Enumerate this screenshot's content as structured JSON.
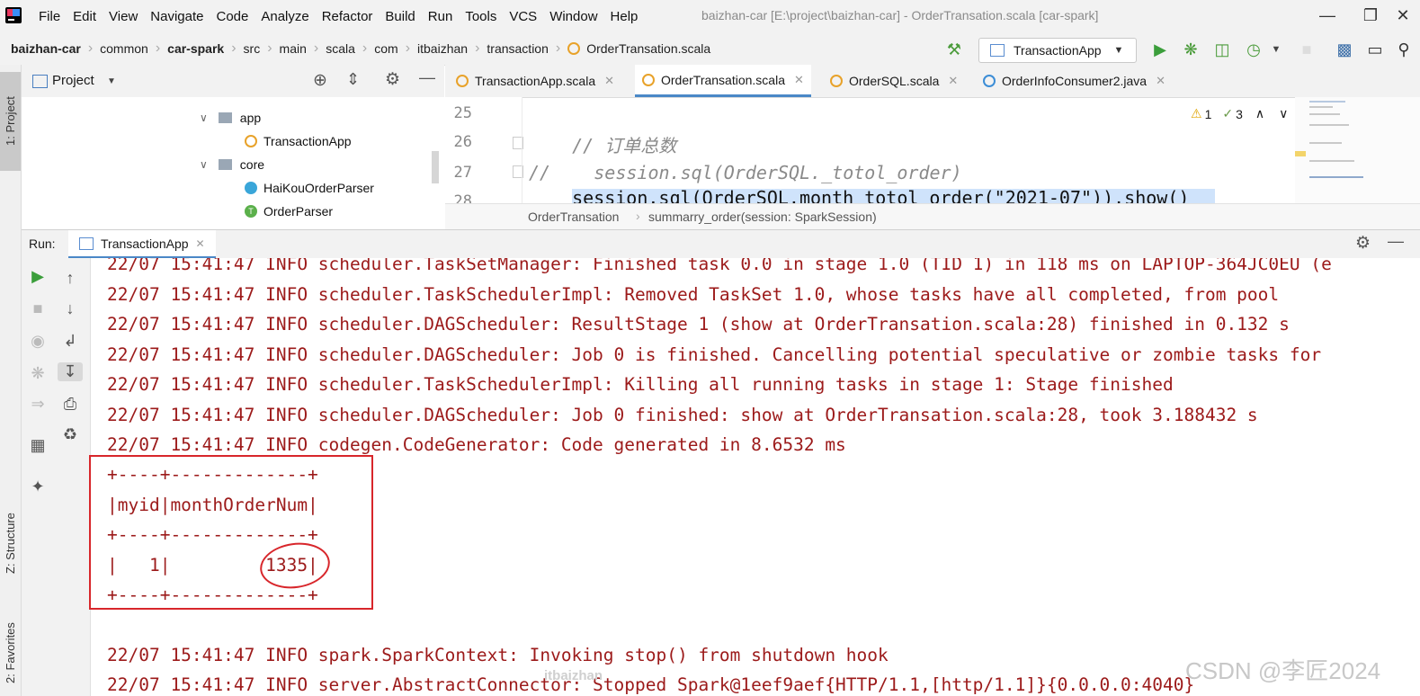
{
  "window": {
    "title": "baizhan-car [E:\\project\\baizhan-car] - OrderTransation.scala [car-spark]",
    "menu": [
      "File",
      "Edit",
      "View",
      "Navigate",
      "Code",
      "Analyze",
      "Refactor",
      "Build",
      "Run",
      "Tools",
      "VCS",
      "Window",
      "Help"
    ]
  },
  "nav": {
    "breadcrumbs": [
      "baizhan-car",
      "common",
      "car-spark",
      "src",
      "main",
      "scala",
      "com",
      "itbaizhan",
      "transaction",
      "OrderTransation.scala"
    ],
    "run_config": "TransactionApp"
  },
  "left_stripe": {
    "project_tab": "1: Project",
    "structure_tab": "Z: Structure",
    "favorites_tab": "2: Favorites"
  },
  "project_panel": {
    "title": "Project",
    "tree": [
      {
        "label": "app",
        "type": "folder",
        "expanded": true
      },
      {
        "label": "TransactionApp",
        "type": "scala-object"
      },
      {
        "label": "core",
        "type": "folder",
        "expanded": true
      },
      {
        "label": "HaiKouOrderParser",
        "type": "scala-class"
      },
      {
        "label": "OrderParser",
        "type": "scala-trait"
      }
    ]
  },
  "editor": {
    "tabs": [
      {
        "label": "TransactionApp.scala",
        "active": false
      },
      {
        "label": "OrderTransation.scala",
        "active": true
      },
      {
        "label": "OrderSQL.scala",
        "active": false
      },
      {
        "label": "OrderInfoConsumer2.java",
        "active": false
      }
    ],
    "line_numbers": [
      "25",
      "26",
      "27",
      "28"
    ],
    "code_lines": [
      "",
      "  // 订单总数",
      "//    session.sql(OrderSQL._totol_order)",
      "  session.sql(OrderSQL.month_totol_order(\"2021-07\")).show()"
    ],
    "inspections": {
      "warnings": "1",
      "weak_warnings": "3"
    },
    "breadcrumb": [
      "OrderTransation",
      "summarry_order(session: SparkSession)"
    ]
  },
  "run_panel": {
    "label": "Run:",
    "tab": "TransactionApp",
    "log_lines": [
      "22/07 15:41:47 INFO scheduler.TaskSetManager: Finished task 0.0 in stage 1.0 (TID 1) in 118 ms on LAPTOP-364JC0EU (e",
      "22/07 15:41:47 INFO scheduler.TaskSchedulerImpl: Removed TaskSet 1.0, whose tasks have all completed, from pool",
      "22/07 15:41:47 INFO scheduler.DAGScheduler: ResultStage 1 (show at OrderTransation.scala:28) finished in 0.132 s",
      "22/07 15:41:47 INFO scheduler.DAGScheduler: Job 0 is finished. Cancelling potential speculative or zombie tasks for",
      "22/07 15:41:47 INFO scheduler.TaskSchedulerImpl: Killing all running tasks in stage 1: Stage finished",
      "22/07 15:41:47 INFO scheduler.DAGScheduler: Job 0 finished: show at OrderTransation.scala:28, took 3.188432 s",
      "22/07 15:41:47 INFO codegen.CodeGenerator: Code generated in 8.6532 ms"
    ],
    "table_lines": [
      "+----+-------------+",
      "|myid|monthOrderNum|",
      "+----+-------------+",
      "|   1|         1335|",
      "+----+-------------+"
    ],
    "tail_lines": [
      "22/07 15:41:47 INFO spark.SparkContext: Invoking stop() from shutdown hook",
      "22/07 15:41:47 INFO server.AbstractConnector: Stopped Spark@1eef9aef{HTTP/1.1,[http/1.1]}{0.0.0.0:4040}"
    ]
  },
  "watermark": "CSDN @李匠2024",
  "watermark2": "itbaizhan"
}
